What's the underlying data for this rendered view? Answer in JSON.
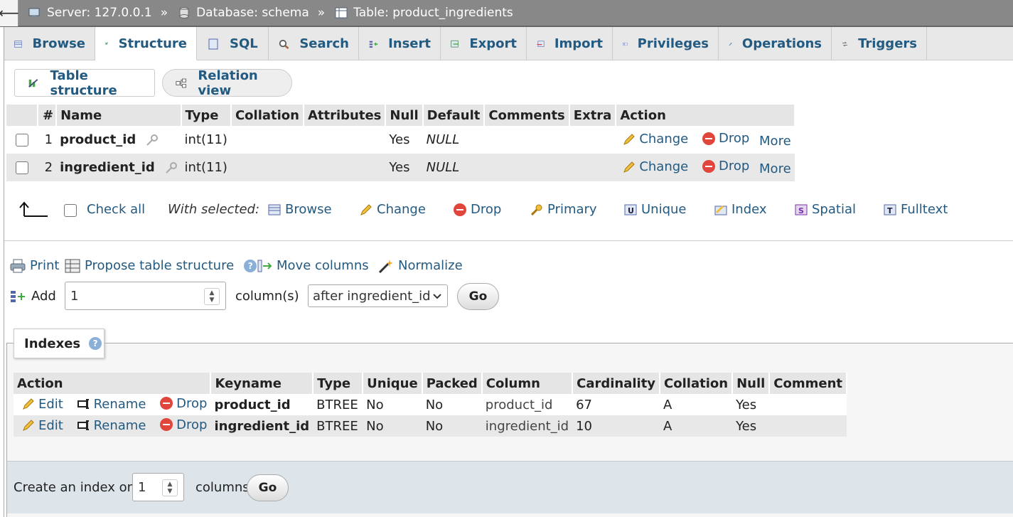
{
  "breadcrumb": {
    "server": "Server: 127.0.0.1",
    "database": "Database: schema",
    "table": "Table: product_ingredients",
    "sep": "»"
  },
  "tabs": [
    "Browse",
    "Structure",
    "SQL",
    "Search",
    "Insert",
    "Export",
    "Import",
    "Privileges",
    "Operations",
    "Triggers"
  ],
  "active_tab": "Structure",
  "subtabs": {
    "table_structure": "Table structure",
    "relation_view": "Relation view"
  },
  "structure": {
    "headers": [
      "#",
      "Name",
      "Type",
      "Collation",
      "Attributes",
      "Null",
      "Default",
      "Comments",
      "Extra",
      "Action"
    ],
    "rows": [
      {
        "num": "1",
        "name": "product_id",
        "type": "int(11)",
        "collation": "",
        "attributes": "",
        "null": "Yes",
        "default": "NULL",
        "comments": "",
        "extra": ""
      },
      {
        "num": "2",
        "name": "ingredient_id",
        "type": "int(11)",
        "collation": "",
        "attributes": "",
        "null": "Yes",
        "default": "NULL",
        "comments": "",
        "extra": ""
      }
    ],
    "actions": {
      "change": "Change",
      "drop": "Drop",
      "more": "More"
    }
  },
  "with_selected": {
    "check_all": "Check all",
    "label": "With selected:",
    "browse": "Browse",
    "change": "Change",
    "drop": "Drop",
    "primary": "Primary",
    "unique": "Unique",
    "index": "Index",
    "spatial": "Spatial",
    "fulltext": "Fulltext"
  },
  "tools": {
    "print": "Print",
    "propose": "Propose table structure",
    "move": "Move columns",
    "normalize": "Normalize"
  },
  "add_columns": {
    "label": "Add",
    "value": "1",
    "suffix": "column(s)",
    "position": "after ingredient_id",
    "go": "Go"
  },
  "indexes": {
    "title": "Indexes",
    "headers": [
      "Action",
      "Keyname",
      "Type",
      "Unique",
      "Packed",
      "Column",
      "Cardinality",
      "Collation",
      "Null",
      "Comment"
    ],
    "actions": {
      "edit": "Edit",
      "rename": "Rename",
      "drop": "Drop"
    },
    "rows": [
      {
        "keyname": "product_id",
        "type": "BTREE",
        "unique": "No",
        "packed": "No",
        "column": "product_id",
        "cardinality": "67",
        "collation": "A",
        "null": "Yes",
        "comment": ""
      },
      {
        "keyname": "ingredient_id",
        "type": "BTREE",
        "unique": "No",
        "packed": "No",
        "column": "ingredient_id",
        "cardinality": "10",
        "collation": "A",
        "null": "Yes",
        "comment": ""
      }
    ]
  },
  "create_index": {
    "label": "Create an index on",
    "value": "1",
    "suffix": "columns",
    "go": "Go"
  },
  "colors": {
    "link": "#235a81",
    "topbar": "#888888",
    "drop": "#e0463c"
  }
}
